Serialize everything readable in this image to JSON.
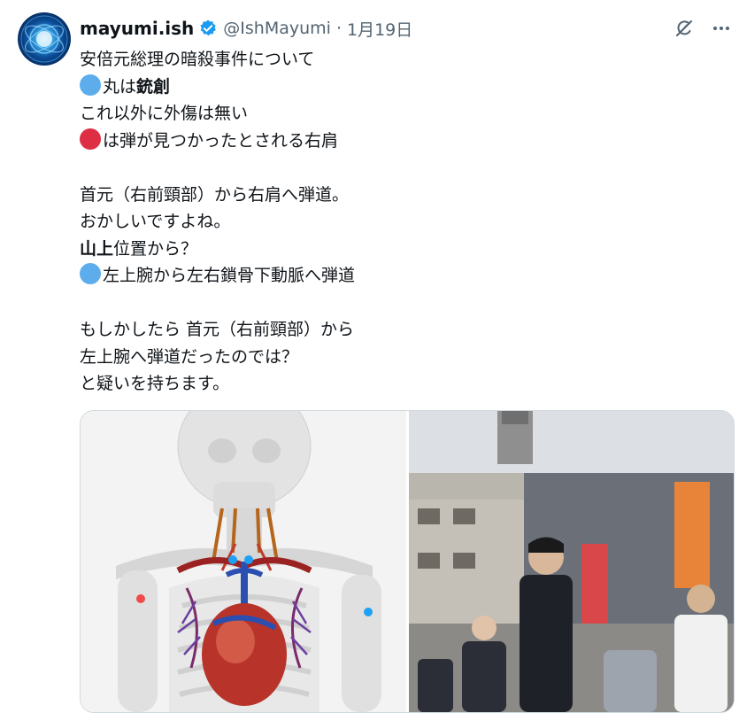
{
  "tweet": {
    "display_name": "mayumi.ish",
    "handle": "@IshMayumi",
    "separator": "·",
    "date": "1月19日",
    "lines": [
      {
        "parts": [
          {
            "t": "安倍元総理の暗殺事件について"
          }
        ]
      },
      {
        "parts": [
          {
            "dot": "blue"
          },
          {
            "t": "丸は"
          },
          {
            "t": "銃創",
            "b": true
          }
        ]
      },
      {
        "parts": [
          {
            "t": "これ以外に外傷は無い"
          }
        ]
      },
      {
        "parts": [
          {
            "dot": "red"
          },
          {
            "t": "は弾が見つかったとされる右肩"
          }
        ]
      },
      {
        "gap": true
      },
      {
        "parts": [
          {
            "t": "首元（右前頸部）から右肩へ弾道。"
          }
        ]
      },
      {
        "parts": [
          {
            "t": "おかしいですよね。"
          }
        ]
      },
      {
        "parts": [
          {
            "t": "山上",
            "b": true
          },
          {
            "t": "位置から？"
          }
        ]
      },
      {
        "parts": [
          {
            "dot": "blue"
          },
          {
            "t": "左上腕から左右鎖骨下動脈へ弾道"
          }
        ]
      },
      {
        "gap": true
      },
      {
        "parts": [
          {
            "t": "もしかしたら 首元（右前頸部）から"
          }
        ]
      },
      {
        "parts": [
          {
            "t": "左上腕へ弾道だったのでは？"
          }
        ]
      },
      {
        "parts": [
          {
            "t": "と疑いを持ちます。"
          }
        ]
      }
    ]
  },
  "icons": {
    "verified": "verified-badge-icon",
    "grok": "grok-icon",
    "more": "more-icon"
  },
  "colors": {
    "accent_blue": "#1d9bf0",
    "dot_blue": "#5dadec",
    "dot_red": "#dd2e44",
    "secondary_text": "#536471"
  }
}
